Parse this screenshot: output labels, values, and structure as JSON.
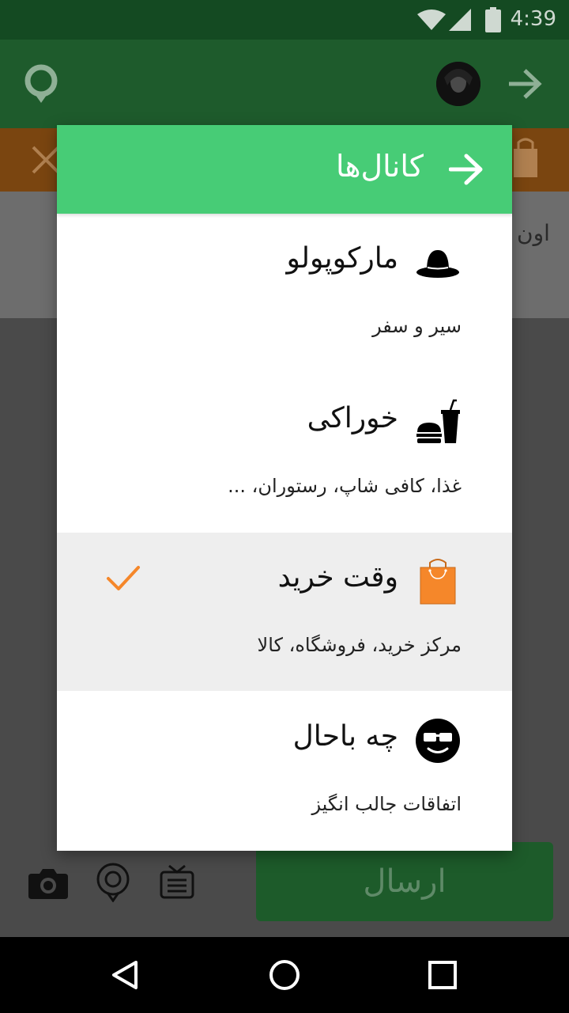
{
  "status_bar": {
    "time": "4:39"
  },
  "background": {
    "partial_text": "اون",
    "send_button_label": "ارسال"
  },
  "dialog": {
    "title": "کانال‌ها",
    "channels": [
      {
        "title": "مارکوپولو",
        "subtitle": "سیر و سفر",
        "icon": "hat-icon",
        "selected": false
      },
      {
        "title": "خوراکی",
        "subtitle": "غذا، کافی شاپ، رستوران، ...",
        "icon": "burger-drink-icon",
        "selected": false
      },
      {
        "title": "وقت خرید",
        "subtitle": "مرکز خرید، فروشگاه، کالا",
        "icon": "shopping-bag-icon",
        "selected": true
      },
      {
        "title": "چه باحال",
        "subtitle": "اتفاقات جالب انگیز",
        "icon": "cool-face-icon",
        "selected": false
      }
    ]
  },
  "colors": {
    "header_green": "#47cc76",
    "accent_orange": "#f5872a",
    "status_green": "#144a22"
  }
}
